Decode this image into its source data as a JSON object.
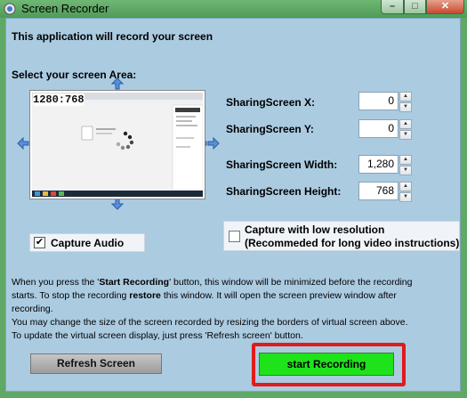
{
  "window": {
    "title": "Screen Recorder",
    "controls": {
      "minimize": "–",
      "maximize": "□",
      "close": "✕"
    }
  },
  "intro": "This application will record your screen",
  "area_label": "Select your screen Area:",
  "preview": {
    "resolution": "1280:768"
  },
  "fields": [
    {
      "label": "SharingScreen X:",
      "value": "0"
    },
    {
      "label": "SharingScreen Y:",
      "value": "0"
    },
    {
      "label": "SharingScreen Width:",
      "value": "1,280"
    },
    {
      "label": "SharingScreen Height:",
      "value": "768"
    }
  ],
  "capture_audio": {
    "label": "Capture Audio",
    "checked": true
  },
  "low_res": {
    "line1": "Capture with low resolution",
    "line2": "(Recommeded for long video instructions)",
    "checked": false
  },
  "info": {
    "l1_a": "When you press the '",
    "l1_b": "Start Recording",
    "l1_c": "' button, this window will be minimized before the recording",
    "l2_a": "starts. To stop the recording ",
    "l2_b": "restore",
    "l2_c": " this window.   It will open the screen preview window after",
    "l3": "recording.",
    "l4": "You may change the size of the screen recorded by resizing the borders of virtual screen above.",
    "l5": "To update the virtual screen display, just press 'Refresh screen' button."
  },
  "buttons": {
    "refresh": "Refresh Screen",
    "start": "start Recording"
  },
  "colors": {
    "background": "#abcbe1",
    "start_button": "#1fe31a",
    "highlight": "#e01b1b"
  }
}
